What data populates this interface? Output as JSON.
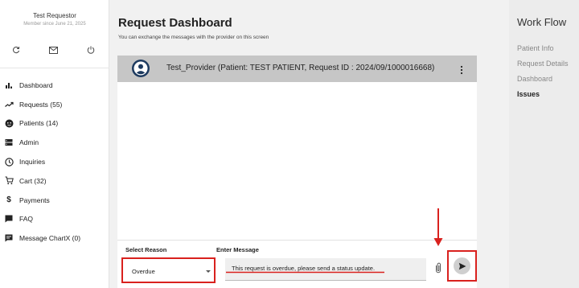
{
  "user": {
    "name": "Test Requestor",
    "member_since": "Member since June 21, 2025"
  },
  "sidebar": {
    "actions": [
      "refresh-icon",
      "mail-icon",
      "power-icon"
    ],
    "items": [
      {
        "label": "Dashboard",
        "icon": "bar-chart-icon"
      },
      {
        "label": "Requests (55)",
        "icon": "trending-icon"
      },
      {
        "label": "Patients (14)",
        "icon": "face-icon"
      },
      {
        "label": "Admin",
        "icon": "server-icon"
      },
      {
        "label": "Inquiries",
        "icon": "clock-icon"
      },
      {
        "label": "Cart (32)",
        "icon": "cart-icon"
      },
      {
        "label": "Payments",
        "icon": "dollar-icon"
      },
      {
        "label": "FAQ",
        "icon": "faq-icon"
      },
      {
        "label": "Message ChartX (0)",
        "icon": "message-icon"
      }
    ]
  },
  "main": {
    "title": "Request Dashboard",
    "subtitle": "You can exchange the messages with the provider on this screen",
    "chat_header": "Test_Provider (Patient: TEST PATIENT, Request ID : 2024/09/1000016668)",
    "compose": {
      "reason_label": "Select Reason",
      "reason_value": "Overdue",
      "message_label": "Enter Message",
      "message_value": "This request is overdue, please send a status update."
    }
  },
  "workflow": {
    "title": "Work Flow",
    "items": [
      {
        "label": "Patient Info",
        "active": false
      },
      {
        "label": "Request Details",
        "active": false
      },
      {
        "label": "Dashboard",
        "active": false
      },
      {
        "label": "Issues",
        "active": true
      }
    ]
  },
  "colors": {
    "annotation": "#d9211e",
    "header_bar": "#c6c6c6",
    "avatar": "#1d3a5f"
  }
}
